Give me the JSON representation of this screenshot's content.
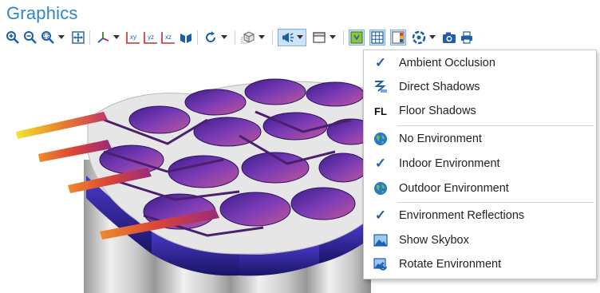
{
  "window": {
    "title": "Graphics"
  },
  "menu": {
    "items": [
      {
        "label": "Ambient Occlusion",
        "icon": "checkmark-icon",
        "checked": true
      },
      {
        "label": "Direct Shadows",
        "icon": "direct-shadows-icon",
        "checked": false
      },
      {
        "label": "Floor Shadows",
        "icon": "floor-shadows-icon",
        "icon_text": "FL",
        "checked": false
      },
      {
        "label": "No Environment",
        "icon": "globe-icon",
        "checked": false
      },
      {
        "label": "Indoor Environment",
        "icon": "checkmark-icon",
        "checked": true
      },
      {
        "label": "Outdoor Environment",
        "icon": "globe-icon",
        "checked": false
      },
      {
        "label": "Environment Reflections",
        "icon": "checkmark-icon",
        "checked": true
      },
      {
        "label": "Show Skybox",
        "icon": "skybox-icon",
        "checked": false
      },
      {
        "label": "Rotate Environment",
        "icon": "rotate-environment-icon",
        "checked": false
      }
    ]
  },
  "colors": {
    "accent": "#2e86c8",
    "check": "#1e5fb4",
    "active_button_bg": "#cfe3f7"
  }
}
